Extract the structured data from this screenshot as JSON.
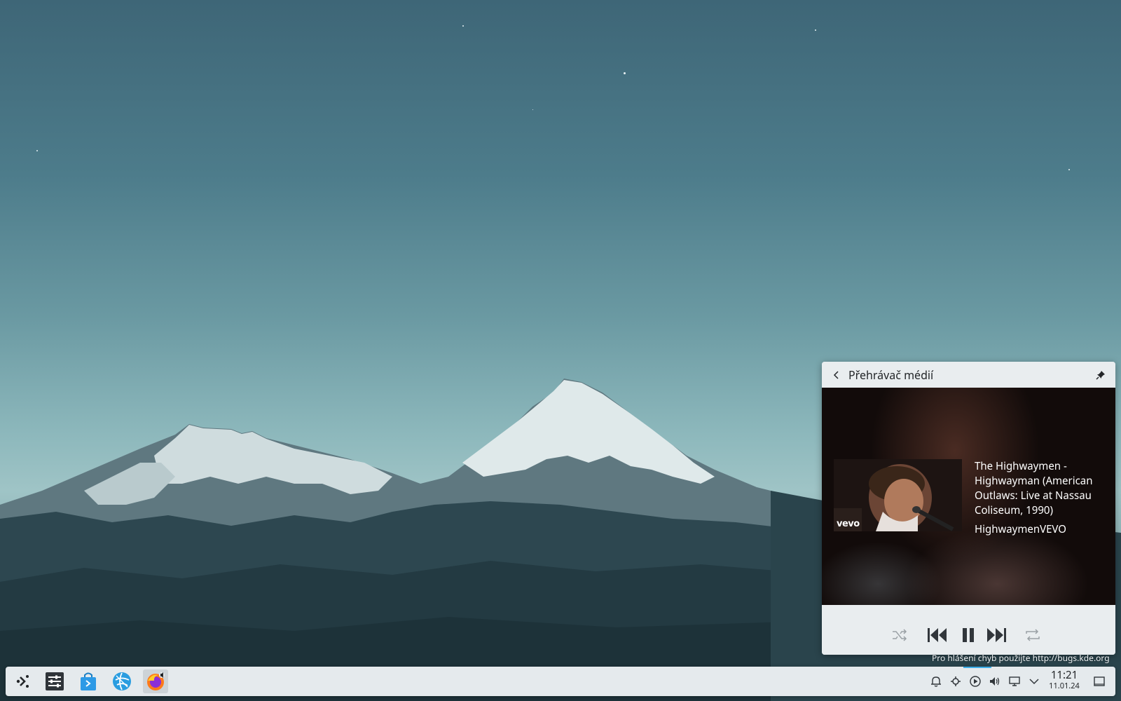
{
  "popup": {
    "title": "Přehrávač médií",
    "back_icon": "chevron-left-icon",
    "pin_icon": "pin-icon"
  },
  "media": {
    "track_title": "The Highwaymen - Highwayman (American Outlaws: Live at Nassau Coliseum, 1990)",
    "artist": "HighwaymenVEVO",
    "album_art_watermark": "vevo",
    "controls": {
      "shuffle_icon": "shuffle-icon",
      "previous_icon": "skip-previous-icon",
      "playpause_icon": "pause-icon",
      "next_icon": "skip-next-icon",
      "repeat_icon": "repeat-icon"
    }
  },
  "desktop": {
    "bug_report_text": "Pro hlášení chyb použijte http://bugs.kde.org"
  },
  "taskbar": {
    "apps": [
      {
        "name": "application-launcher",
        "icon": "kde-launcher-icon"
      },
      {
        "name": "system-settings",
        "icon": "settings-sliders-icon"
      },
      {
        "name": "discover",
        "icon": "shopping-bag-icon"
      },
      {
        "name": "web-browser",
        "icon": "globe-icon"
      },
      {
        "name": "firefox",
        "icon": "firefox-icon",
        "active": true
      }
    ],
    "tray": [
      "notifications-icon",
      "kde-connect-icon",
      "media-player-icon",
      "volume-icon",
      "network-icon",
      "expand-tray-icon"
    ],
    "clock": {
      "time": "11:21",
      "date": "11.01.24"
    },
    "show_desktop_icon": "show-desktop-icon"
  },
  "colors": {
    "accent": "#3daee9",
    "panel": "#e5eaed",
    "popup": "#e9edef"
  }
}
